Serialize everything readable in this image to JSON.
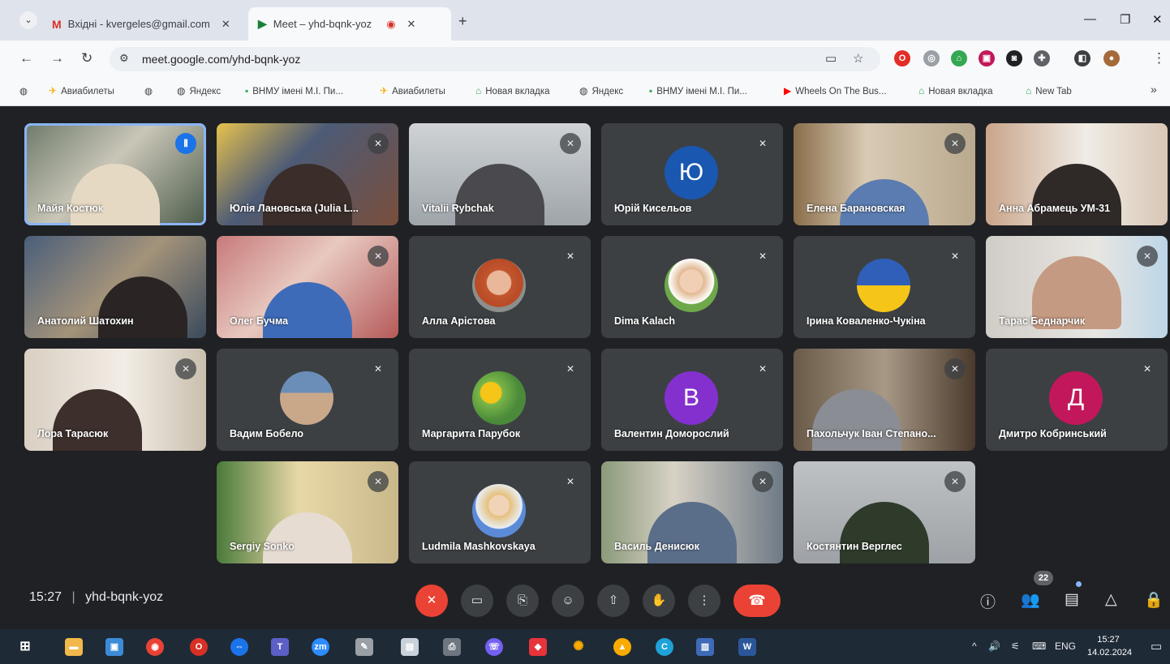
{
  "browser": {
    "tabs": [
      {
        "label": "Вхідні - kvergeles@gmail.com",
        "icon": "gmail-icon"
      },
      {
        "label": "Meet – yhd-bqnk-yoz",
        "icon": "meet-icon"
      }
    ],
    "tab_close_glyph": "✕",
    "new_tab_glyph": "+",
    "url": "meet.google.com/yhd-bqnk-yoz",
    "bookmarks": [
      "Авиабилеты",
      "Яндекс",
      "ВНМУ імені М.І. Пи...",
      "Авиабилеты",
      "Новая вкладка",
      "Яндекс",
      "ВНМУ імені М.І. Пи...",
      "Wheels On The Bus...",
      "Новая вкладка",
      "New Tab"
    ],
    "bookmarks_overflow": "»"
  },
  "meet": {
    "participants": [
      {
        "name": "Майя Костюк",
        "type": "video",
        "speaking": true
      },
      {
        "name": "Юлія Лановська (Julia L...",
        "type": "video"
      },
      {
        "name": "Vitalii Rybchak",
        "type": "video"
      },
      {
        "name": "Юрій Кисельов",
        "type": "initial",
        "initial": "Ю",
        "color": "#1a57b0"
      },
      {
        "name": "Елена Барановская",
        "type": "video"
      },
      {
        "name": "Анна Абрамець УМ-31",
        "type": "video"
      },
      {
        "name": "Анатолий Шатохин",
        "type": "video"
      },
      {
        "name": "Олег Бучма",
        "type": "video"
      },
      {
        "name": "Алла Арістова",
        "type": "photo"
      },
      {
        "name": "Dima Kalach",
        "type": "photo"
      },
      {
        "name": "Ірина Коваленко-Чукіна",
        "type": "photo"
      },
      {
        "name": "Тарас Беднарчик",
        "type": "video"
      },
      {
        "name": "Лора Тарасюк",
        "type": "video"
      },
      {
        "name": "Вадим Бобело",
        "type": "photo"
      },
      {
        "name": "Маргарита Парубок",
        "type": "photo"
      },
      {
        "name": "Валентин Доморослий",
        "type": "initial",
        "initial": "В",
        "color": "#8430ce"
      },
      {
        "name": "Пахольчук Іван Степано...",
        "type": "video"
      },
      {
        "name": "Дмитро Кобринський",
        "type": "initial",
        "initial": "Д",
        "color": "#c2185b"
      },
      {
        "name": "Sergiy Sonko",
        "type": "video"
      },
      {
        "name": "Ludmila Mashkovskaya",
        "type": "photo"
      },
      {
        "name": "Василь Денисюк",
        "type": "video"
      },
      {
        "name": "Костянтин Верглес",
        "type": "video"
      }
    ],
    "time": "15:27",
    "meeting_code": "yhd-bqnk-yoz",
    "time_separator": "|",
    "people_count": "22"
  },
  "taskbar": {
    "language": "ENG",
    "time": "15:27",
    "date": "14.02.2024"
  }
}
